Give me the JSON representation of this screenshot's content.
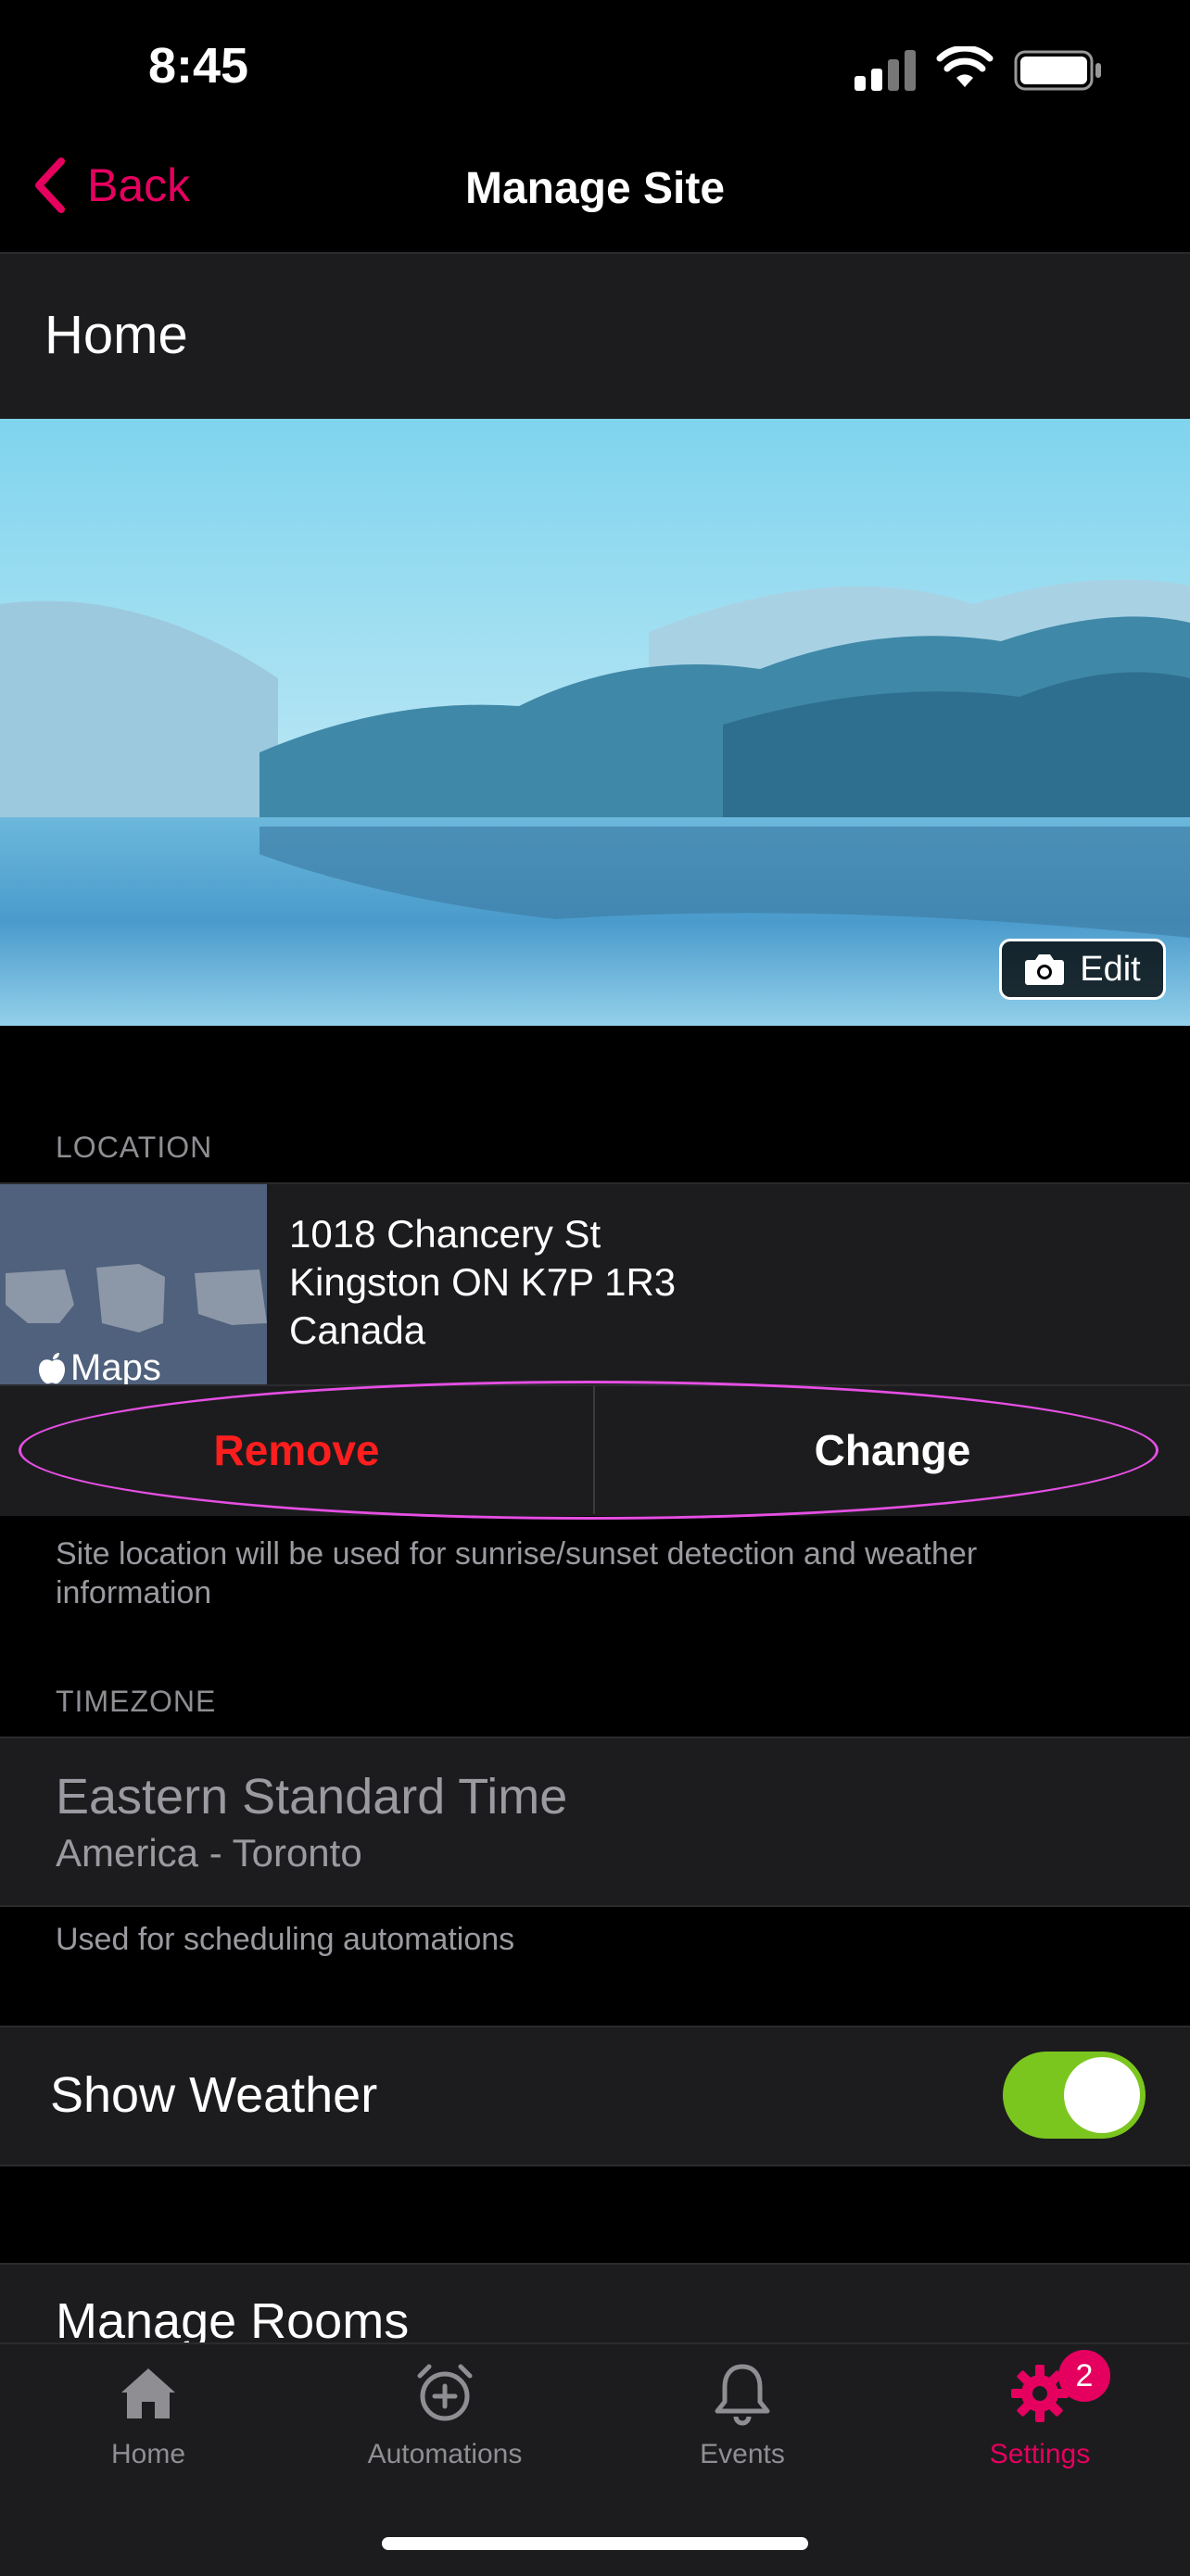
{
  "status_bar": {
    "time": "8:45"
  },
  "nav": {
    "back_label": "Back",
    "title": "Manage Site"
  },
  "site": {
    "name": "Home",
    "edit_label": "Edit"
  },
  "location": {
    "section_label": "LOCATION",
    "address_line1": "1018 Chancery St",
    "address_line2": "Kingston ON K7P 1R3",
    "address_line3": "Canada",
    "maps_label": "Maps",
    "remove_label": "Remove",
    "change_label": "Change",
    "footnote": "Site location will be used for sunrise/sunset detection and weather information"
  },
  "timezone": {
    "section_label": "TIMEZONE",
    "name": "Eastern Standard Time",
    "region": "America - Toronto",
    "footnote": "Used for scheduling automations"
  },
  "weather": {
    "label": "Show Weather",
    "enabled": true
  },
  "rooms": {
    "label": "Manage Rooms"
  },
  "tabbar": {
    "home": "Home",
    "automations": "Automations",
    "events": "Events",
    "settings": "Settings",
    "settings_badge": "2"
  },
  "colors": {
    "accent": "#e5005f",
    "remove": "#ff1e1e",
    "toggle_on": "#7ac61e",
    "highlight": "#e54fe3"
  },
  "icons": [
    "chevron-left-icon",
    "camera-icon",
    "apple-logo-icon",
    "home-icon",
    "alarm-plus-icon",
    "bell-icon",
    "gear-icon",
    "chevron-right-icon"
  ]
}
